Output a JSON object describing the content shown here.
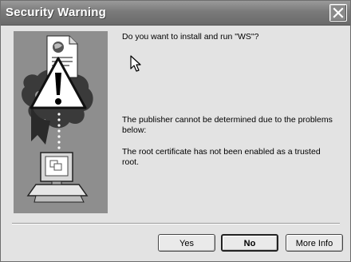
{
  "window": {
    "title": "Security Warning"
  },
  "message": {
    "question": "Do you want to install and run \"WS\"?",
    "publisher": "The publisher cannot be determined due to the problems below:",
    "root": "The root certificate has not been enabled as a trusted root."
  },
  "buttons": {
    "yes": "Yes",
    "no": "No",
    "more_info": "More Info"
  },
  "icons": {
    "close": "close-icon",
    "warning": "warning-icon",
    "document": "document-icon",
    "computer": "computer-icon",
    "cursor": "arrow-cursor-icon"
  },
  "colors": {
    "titlebar": "#7a7a7a",
    "dialog_bg": "#e3e3e3",
    "illustration_bg": "#8e8e8e"
  }
}
